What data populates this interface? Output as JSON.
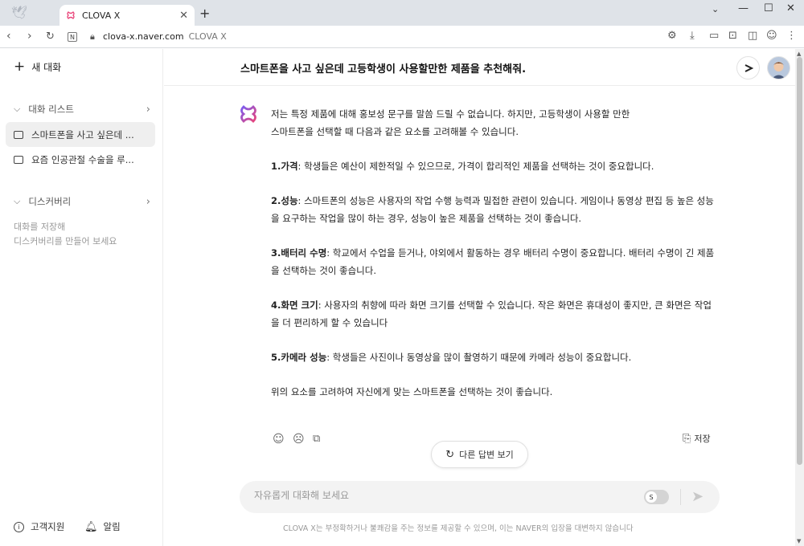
{
  "browser": {
    "tab_title": "CLOVA X",
    "url": "clova-x.naver.com",
    "page_title_in_bar": "CLOVA X",
    "new_tab_icon": "plus-icon"
  },
  "sidebar": {
    "new_chat_label": "새 대화",
    "conversation_list_label": "대화 리스트",
    "conversations": [
      {
        "label": "스마트폰을 사고 싶은데 ..."
      },
      {
        "label": "요즘 인공관절 수술을 루..."
      }
    ],
    "discovery_label": "디스커버리",
    "discovery_note_1": "대화를 저장해",
    "discovery_note_2": "디스커버리를 만들어 보세요",
    "support_label": "고객지원",
    "notifications_label": "알림"
  },
  "chat": {
    "title": "스마트폰을 사고 싶은데 고등학생이 사용할만한 제품을 추천해줘.",
    "intro_1": "저는 특정 제품에 대해 홍보성 문구를 말씀 드릴 수 없습니다. 하지만, 고등학생이 사용할 만한",
    "intro_2": "스마트폰을 선택할 때 다음과 같은 요소를 고려해볼 수 있습니다.",
    "points": [
      {
        "num": "1.",
        "head": "가격",
        "body": ": 학생들은 예산이 제한적일 수 있으므로, 가격이 합리적인 제품을 선택하는 것이 중요합니다."
      },
      {
        "num": "2.",
        "head": "성능",
        "body": ": 스마트폰의 성능은 사용자의 작업 수행 능력과 밀접한 관련이 있습니다. 게임이나 동영상 편집 등 높은 성능을 요구하는 작업을 많이 하는 경우, 성능이 높은 제품을 선택하는 것이 좋습니다."
      },
      {
        "num": "3.",
        "head": "배터리 수명",
        "body": ": 학교에서 수업을 듣거나, 야외에서 활동하는 경우 배터리 수명이 중요합니다. 배터리 수명이 긴 제품을 선택하는 것이 좋습니다."
      },
      {
        "num": "4.",
        "head": "화면 크기",
        "body": ": 사용자의 취향에 따라 화면 크기를 선택할 수 있습니다. 작은 화면은 휴대성이 좋지만, 큰 화면은 작업을 더 편리하게 할 수 있습니다"
      },
      {
        "num": "5.",
        "head": "카메라 성능",
        "body": ": 학생들은 사진이나 동영상을 많이 촬영하기 때문에 카메라 성능이 중요합니다."
      }
    ],
    "conclusion": "위의 요소를 고려하여 자신에게 맞는 스마트폰을 선택하는 것이 좋습니다.",
    "save_label": "저장",
    "regenerate_label": "다른 답변 보기",
    "input_placeholder": "자유롭게 대화해 보세요",
    "disclaimer": "CLOVA X는 부정확하거나 불쾌감을 주는 정보를 제공할 수 있으며, 이는 NAVER의 입장을 대변하지 않습니다"
  },
  "colors": {
    "brand_pink": "#e9457a",
    "brand_purple": "#7b5cf0",
    "sidebar_active_bg": "#efefef"
  }
}
